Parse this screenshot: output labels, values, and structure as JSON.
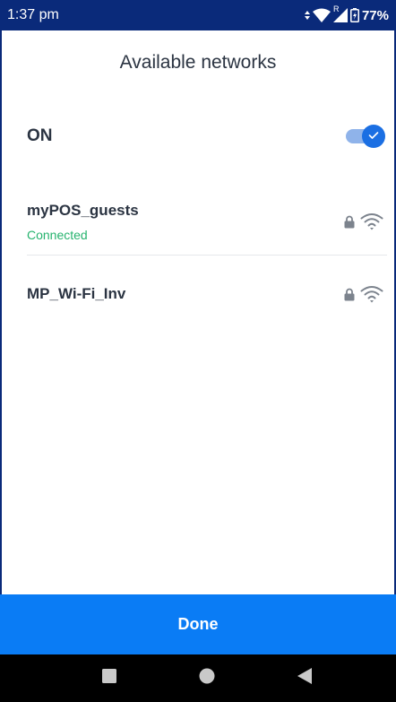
{
  "status_bar": {
    "time": "1:37 pm",
    "battery": "77%",
    "roaming_indicator": "R",
    "icons": [
      "data-activity-icon",
      "wifi-signal-icon",
      "cellular-signal-icon",
      "battery-icon"
    ]
  },
  "page": {
    "title": "Available networks"
  },
  "wifi_toggle": {
    "label": "ON",
    "enabled": true
  },
  "networks": [
    {
      "name": "myPOS_guests",
      "status": "Connected",
      "secured": true,
      "icons": [
        "lock-icon",
        "wifi-icon"
      ]
    },
    {
      "name": "MP_Wi-Fi_Inv",
      "status": "",
      "secured": true,
      "icons": [
        "lock-icon",
        "wifi-icon"
      ]
    }
  ],
  "footer": {
    "done_label": "Done"
  },
  "nav_bar": {
    "icons": [
      "recents-square-icon",
      "home-circle-icon",
      "back-triangle-icon"
    ]
  },
  "colors": {
    "status_bar_bg": "#0a2a7a",
    "title_text": "#2b3442",
    "accent_blue": "#0a7cf5",
    "toggle_blue": "#1b6fe3",
    "connected_green": "#26b36e",
    "icon_gray": "#7c838d",
    "nav_bar_bg": "#000000"
  }
}
